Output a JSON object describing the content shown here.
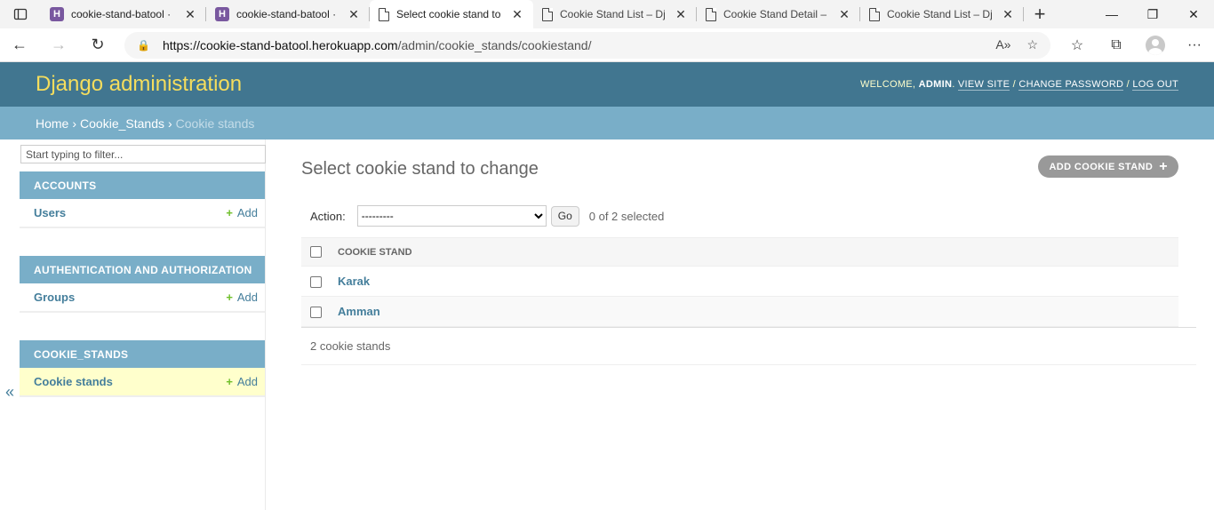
{
  "browser": {
    "tabs": [
      {
        "title": "cookie-stand-batool ·",
        "icon": "heroku-icon",
        "active": false
      },
      {
        "title": "cookie-stand-batool ·",
        "icon": "heroku-icon",
        "active": false
      },
      {
        "title": "Select cookie stand to",
        "icon": "page-icon",
        "active": true
      },
      {
        "title": "Cookie Stand List – Dj",
        "icon": "page-icon",
        "active": false
      },
      {
        "title": "Cookie Stand Detail –",
        "icon": "page-icon",
        "active": false
      },
      {
        "title": "Cookie Stand List – Dj",
        "icon": "page-icon",
        "active": false
      }
    ],
    "url_host": "https://cookie-stand-batool.herokuapp.com",
    "url_path": "/admin/cookie_stands/cookiestand/"
  },
  "header": {
    "brand": "Django administration",
    "welcome": "WELCOME,",
    "username": "ADMIN",
    "view_site": "VIEW SITE",
    "change_password": "CHANGE PASSWORD",
    "log_out": "LOG OUT",
    "slash": "/"
  },
  "breadcrumbs": {
    "home": "Home",
    "app": "Cookie_Stands",
    "current": "Cookie stands",
    "sep": "›"
  },
  "sidebar": {
    "filter_placeholder": "Start typing to filter...",
    "collapse": "«",
    "modules": [
      {
        "caption": "ACCOUNTS",
        "model": "Users",
        "add": "Add",
        "current": false
      },
      {
        "caption": "AUTHENTICATION AND AUTHORIZATION",
        "model": "Groups",
        "add": "Add",
        "current": false
      },
      {
        "caption": "COOKIE_STANDS",
        "model": "Cookie stands",
        "add": "Add",
        "current": true
      }
    ]
  },
  "content": {
    "title": "Select cookie stand to change",
    "add_button": "ADD COOKIE STAND",
    "action_label": "Action:",
    "action_selected": "---------",
    "go_label": "Go",
    "selection_count": "0 of 2 selected",
    "column_header": "COOKIE STAND",
    "rows": [
      "Karak",
      "Amman"
    ],
    "paginator": "2 cookie stands"
  }
}
